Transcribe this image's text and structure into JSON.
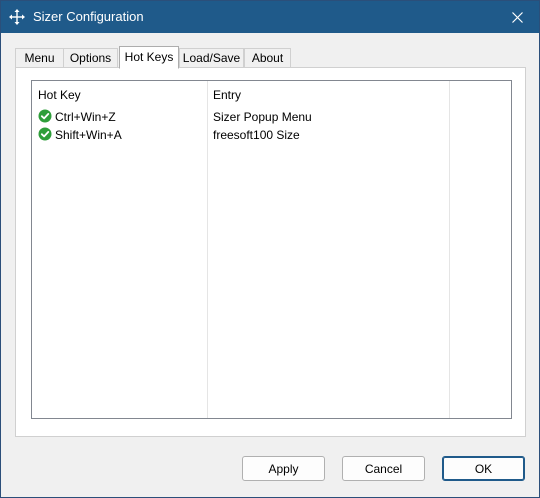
{
  "window": {
    "title": "Sizer Configuration",
    "icon": "move-crosshair-icon",
    "close_glyph": "✕"
  },
  "tabs": [
    {
      "label": "Menu",
      "active": false
    },
    {
      "label": "Options",
      "active": false
    },
    {
      "label": "Hot Keys",
      "active": true
    },
    {
      "label": "Load/Save",
      "active": false
    },
    {
      "label": "About",
      "active": false
    }
  ],
  "hotkeys": {
    "columns": {
      "hotkey": "Hot Key",
      "entry": "Entry"
    },
    "rows": [
      {
        "hotkey": "Ctrl+Win+Z",
        "entry": "Sizer Popup Menu",
        "status_icon": "green-check-icon"
      },
      {
        "hotkey": "Shift+Win+A",
        "entry": "freesoft100 Size",
        "status_icon": "green-check-icon"
      }
    ]
  },
  "buttons": {
    "apply": "Apply",
    "cancel": "Cancel",
    "ok": "OK"
  },
  "colors": {
    "titlebar": "#1f5a8a",
    "check": "#2e9e3a"
  }
}
